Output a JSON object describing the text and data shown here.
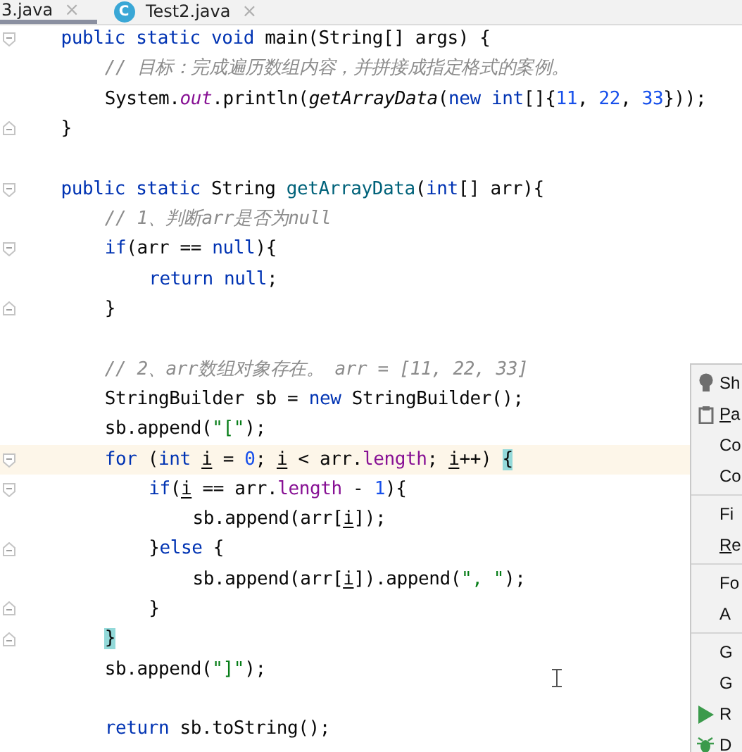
{
  "tabs": [
    {
      "label": "3.java",
      "selected": true,
      "close": "×"
    },
    {
      "label": "Test2.java",
      "selected": false,
      "badge": "C",
      "close": "×"
    }
  ],
  "code_lines": [
    {
      "kind": "code",
      "fold_start": true,
      "tokens": [
        {
          "kind": "keyword",
          "text": "public static void"
        },
        {
          "kind": "plain",
          "text": " main(String[] args) {"
        }
      ],
      "children": [
        {
          "kind": "code",
          "tokens": [
            {
              "kind": "comment",
              "text": "// 目标：完成遍历数组内容，并拼接成指定格式的案例。"
            }
          ]
        },
        {
          "kind": "code",
          "tokens": [
            {
              "kind": "plain",
              "text": "System."
            },
            {
              "kind": "field",
              "text": "out"
            },
            {
              "kind": "plain",
              "text": ".println("
            },
            {
              "kind": "static-call",
              "text": "getArrayData"
            },
            {
              "kind": "plain",
              "text": "("
            },
            {
              "kind": "keyword",
              "text": "new int"
            },
            {
              "kind": "plain",
              "text": "[]{"
            },
            {
              "kind": "number",
              "text": "11"
            },
            {
              "kind": "plain",
              "text": ", "
            },
            {
              "kind": "number",
              "text": "22"
            },
            {
              "kind": "plain",
              "text": ", "
            },
            {
              "kind": "number",
              "text": "33"
            },
            {
              "kind": "plain",
              "text": "}));"
            }
          ]
        }
      ]
    },
    {
      "kind": "code",
      "fold_end": true,
      "tokens": [
        {
          "kind": "plain",
          "text": "}"
        }
      ]
    },
    {
      "kind": "blank"
    },
    {
      "kind": "code",
      "fold_start": true,
      "tokens": [
        {
          "kind": "keyword",
          "text": "public static"
        },
        {
          "kind": "plain",
          "text": " String "
        },
        {
          "kind": "declaration",
          "text": "getArrayData"
        },
        {
          "kind": "plain",
          "text": "("
        },
        {
          "kind": "keyword",
          "text": "int"
        },
        {
          "kind": "plain",
          "text": "[] arr){"
        }
      ],
      "children": [
        {
          "kind": "code",
          "tokens": [
            {
              "kind": "comment",
              "text": "// 1、判断arr是否为null"
            }
          ]
        },
        {
          "kind": "code",
          "fold_start": true,
          "tokens": [
            {
              "kind": "keyword",
              "text": "if"
            },
            {
              "kind": "plain",
              "text": "(arr == "
            },
            {
              "kind": "keyword",
              "text": "null"
            },
            {
              "kind": "plain",
              "text": "){"
            }
          ],
          "children": [
            {
              "kind": "code",
              "tokens": [
                {
                  "kind": "keyword",
                  "text": "return null"
                },
                {
                  "kind": "plain",
                  "text": ";"
                }
              ]
            }
          ]
        },
        {
          "kind": "code",
          "fold_end": true,
          "tokens": [
            {
              "kind": "plain",
              "text": "}"
            }
          ]
        },
        {
          "kind": "blank"
        },
        {
          "kind": "code",
          "tokens": [
            {
              "kind": "comment",
              "text": "// 2、arr数组对象存在。 arr = [11, 22, 33]"
            }
          ]
        },
        {
          "kind": "code",
          "tokens": [
            {
              "kind": "plain",
              "text": "StringBuilder sb = "
            },
            {
              "kind": "keyword",
              "text": "new"
            },
            {
              "kind": "plain",
              "text": " StringBuilder();"
            }
          ]
        },
        {
          "kind": "code",
          "tokens": [
            {
              "kind": "plain",
              "text": "sb.append("
            },
            {
              "kind": "string",
              "text": "\"[\""
            },
            {
              "kind": "plain",
              "text": ");"
            }
          ]
        },
        {
          "kind": "code",
          "current": true,
          "fold_start": true,
          "tokens": [
            {
              "kind": "keyword",
              "text": "for"
            },
            {
              "kind": "plain",
              "text": " ("
            },
            {
              "kind": "keyword",
              "text": "int "
            },
            {
              "kind": "variable",
              "text": "i"
            },
            {
              "kind": "plain",
              "text": " = "
            },
            {
              "kind": "number",
              "text": "0"
            },
            {
              "kind": "plain",
              "text": "; "
            },
            {
              "kind": "variable",
              "text": "i"
            },
            {
              "kind": "plain",
              "text": " < arr."
            },
            {
              "kind": "member",
              "text": "length"
            },
            {
              "kind": "plain",
              "text": "; "
            },
            {
              "kind": "variable",
              "text": "i"
            },
            {
              "kind": "plain",
              "text": "++) "
            },
            {
              "kind": "brace-match",
              "text": "{"
            }
          ],
          "children": [
            {
              "kind": "code",
              "fold_start": true,
              "tokens": [
                {
                  "kind": "keyword",
                  "text": "if"
                },
                {
                  "kind": "plain",
                  "text": "("
                },
                {
                  "kind": "variable",
                  "text": "i"
                },
                {
                  "kind": "plain",
                  "text": " == arr."
                },
                {
                  "kind": "member",
                  "text": "length"
                },
                {
                  "kind": "plain",
                  "text": " - "
                },
                {
                  "kind": "number",
                  "text": "1"
                },
                {
                  "kind": "plain",
                  "text": "){"
                }
              ],
              "children": [
                {
                  "kind": "code",
                  "tokens": [
                    {
                      "kind": "plain",
                      "text": "sb.append(arr["
                    },
                    {
                      "kind": "variable",
                      "text": "i"
                    },
                    {
                      "kind": "plain",
                      "text": "]);"
                    }
                  ]
                }
              ]
            },
            {
              "kind": "code",
              "fold_end": true,
              "tokens": [
                {
                  "kind": "plain",
                  "text": "}"
                },
                {
                  "kind": "keyword",
                  "text": "else"
                },
                {
                  "kind": "plain",
                  "text": " {"
                }
              ],
              "children": [
                {
                  "kind": "code",
                  "tokens": [
                    {
                      "kind": "plain",
                      "text": "sb.append(arr["
                    },
                    {
                      "kind": "variable",
                      "text": "i"
                    },
                    {
                      "kind": "plain",
                      "text": "]).append("
                    },
                    {
                      "kind": "string",
                      "text": "\", \""
                    },
                    {
                      "kind": "plain",
                      "text": ");"
                    }
                  ]
                }
              ]
            },
            {
              "kind": "code",
              "fold_end": true,
              "tokens": [
                {
                  "kind": "plain",
                  "text": "}"
                }
              ]
            }
          ]
        },
        {
          "kind": "code",
          "fold_end": true,
          "tokens": [
            {
              "kind": "brace-match",
              "text": "}"
            }
          ]
        },
        {
          "kind": "code",
          "tokens": [
            {
              "kind": "plain",
              "text": "sb.append("
            },
            {
              "kind": "string",
              "text": "\"]\""
            },
            {
              "kind": "plain",
              "text": ");"
            }
          ]
        },
        {
          "kind": "blank"
        },
        {
          "kind": "code",
          "tokens": [
            {
              "kind": "keyword",
              "text": "return"
            },
            {
              "kind": "plain",
              "text": " sb.toString();"
            }
          ]
        }
      ]
    }
  ],
  "context_menu": [
    {
      "kind": "hint",
      "label": "Sh"
    },
    {
      "kind": "paste",
      "label": "Pa",
      "mnemonic_underlined": true
    },
    {
      "kind": "plain",
      "label": "Co"
    },
    {
      "kind": "plain",
      "label": "Co"
    },
    {
      "kind": "separator"
    },
    {
      "kind": "plain",
      "label": "Fi"
    },
    {
      "kind": "plain",
      "label": "Re",
      "mnemonic_underlined": true
    },
    {
      "kind": "separator"
    },
    {
      "kind": "plain",
      "label": "Fo"
    },
    {
      "kind": "plain",
      "label": "A"
    },
    {
      "kind": "separator"
    },
    {
      "kind": "plain",
      "label": "G"
    },
    {
      "kind": "plain",
      "label": "G"
    },
    {
      "kind": "run",
      "label": "R"
    },
    {
      "kind": "debug",
      "label": "D"
    }
  ]
}
